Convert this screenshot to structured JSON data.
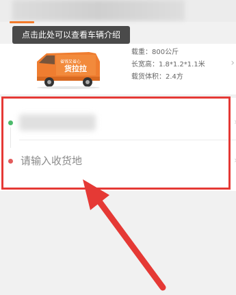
{
  "tooltip": {
    "text": "点击此处可以查看车辆介绍"
  },
  "vehicle": {
    "brand_text": "货拉拉",
    "tagline": "省钱又省心",
    "specs": [
      "载重：800公斤",
      "长宽高：1.8*1.2*1.1米",
      "载货体积：2.4方"
    ]
  },
  "address": {
    "destination_placeholder": "请输入收货地"
  },
  "colors": {
    "accent_orange": "#f27a2a",
    "annotation_red": "#e53935",
    "start_dot": "#4cba6b",
    "end_dot": "#e25b5b"
  }
}
